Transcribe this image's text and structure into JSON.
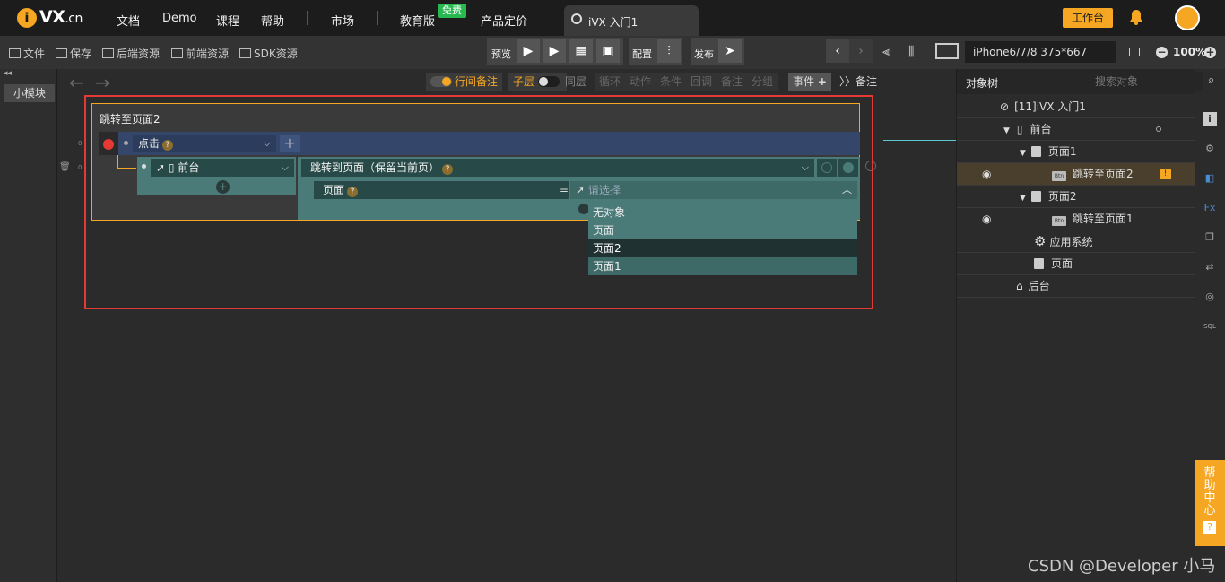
{
  "topbar": {
    "logo_letter": "i",
    "logo_text": "VX",
    "logo_suffix": ".cn",
    "nav": [
      "文档",
      "Demo",
      "课程",
      "帮助"
    ],
    "market": "市场",
    "education": "教育版",
    "free_badge": "免费",
    "pricing": "产品定价",
    "tab_title": "iVX 入门1",
    "workbench": "工作台"
  },
  "toolbar": {
    "file": "文件",
    "save": "保存",
    "backend_res": "后端资源",
    "frontend_res": "前端资源",
    "sdk_res": "SDK资源",
    "preview": "预览",
    "config": "配置",
    "publish": "发布",
    "device": "iPhone6/7/8 375*667",
    "zoom": "100%"
  },
  "left_panel": {
    "small_module": "小模块"
  },
  "subbar": {
    "inline_note": "行间备注",
    "child_layer": "子层",
    "same_layer": "同层",
    "loop": "循环",
    "action": "动作",
    "condition": "条件",
    "callback": "回调",
    "note": "备注",
    "group": "分组",
    "event": "事件",
    "note2": "备注"
  },
  "event": {
    "title": "跳转至页面2",
    "trigger": "点击",
    "target": "前台",
    "action": "跳转到页面（保留当前页）",
    "param_label": "页面",
    "param_eq": "=",
    "param_placeholder": "请选择",
    "row_num_1": "0",
    "row_num_2": "0"
  },
  "dropdown": {
    "options": [
      "无对象",
      "页面",
      "页面2",
      "页面1"
    ],
    "selected_index": 2
  },
  "right_panel": {
    "tab": "对象树",
    "search_placeholder": "搜索对象",
    "tree": [
      {
        "label": "[11]iVX 入门1"
      },
      {
        "label": "前台"
      },
      {
        "label": "页面1"
      },
      {
        "label": "跳转至页面2"
      },
      {
        "label": "页面2"
      },
      {
        "label": "跳转至页面1"
      },
      {
        "label": "应用系统"
      },
      {
        "label": "页面"
      },
      {
        "label": "后台"
      }
    ],
    "btn_tag": "Btn",
    "fx": "Fx",
    "sql": "SQL"
  },
  "help": {
    "label": "帮助中心",
    "q": "?"
  },
  "watermark": "CSDN @Developer 小马",
  "colors": {
    "accent": "#f5a623",
    "highlight_frame": "#e53935",
    "event_row": "#34466a",
    "teal": "#4a7b78"
  }
}
